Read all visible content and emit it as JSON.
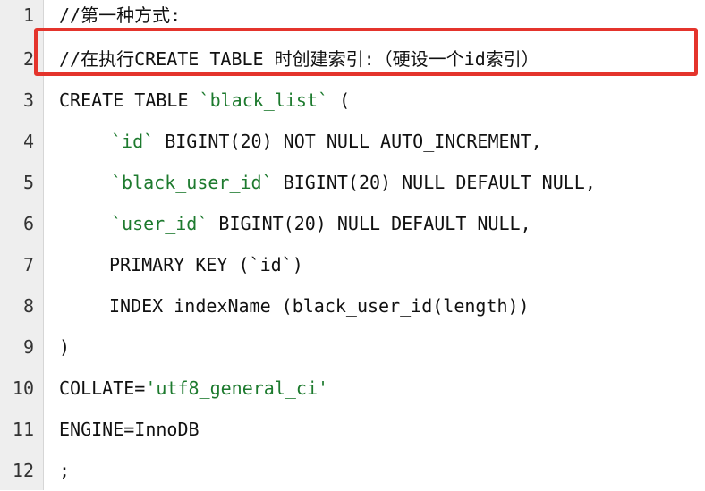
{
  "line_numbers": [
    "1",
    "2",
    "3",
    "4",
    "5",
    "6",
    "7",
    "8",
    "9",
    "10",
    "11",
    "12"
  ],
  "code": {
    "l1": "//第一种方式:",
    "l2": "//在执行CREATE TABLE 时创建索引:（硬设一个id索引）",
    "l3a": "CREATE TABLE ",
    "l3b": "`black_list`",
    "l3c": " (",
    "l4a": "`id`",
    "l4b": " BIGINT(20) NOT NULL AUTO_INCREMENT,",
    "l5a": "`black_user_id`",
    "l5b": " BIGINT(20) NULL DEFAULT NULL,",
    "l6a": "`user_id`",
    "l6b": " BIGINT(20) NULL DEFAULT NULL,",
    "l7": "PRIMARY KEY (`id`)",
    "l8": "INDEX indexName (black_user_id(length))",
    "l9": ")",
    "l10a": "COLLATE=",
    "l10b": "'utf8_general_ci'",
    "l11": "ENGINE=InnoDB",
    "l12": ";"
  },
  "colors": {
    "highlight_border": "#e4342c",
    "string": "#1d7a2e",
    "gutter_bg": "#eeeeee"
  }
}
